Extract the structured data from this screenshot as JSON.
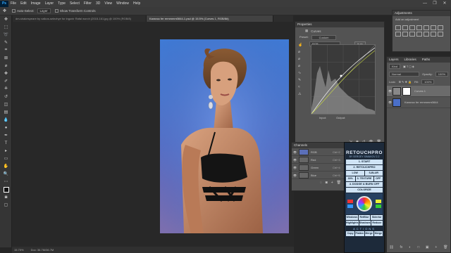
{
  "menubar": {
    "logo": "Ps",
    "items": [
      "File",
      "Edit",
      "Image",
      "Layer",
      "Type",
      "Select",
      "Filter",
      "3D",
      "View",
      "Window",
      "Help"
    ],
    "window_controls": [
      "—",
      "❐",
      "✕"
    ]
  },
  "options": {
    "auto_select_label": "Auto-Select:",
    "auto_select_value": "Layer",
    "transform_label": "Show Transform Controls"
  },
  "tabs": [
    {
      "label": "dm-shakespeare by valkos-selezhye for ingonir Rafal worch (2015-161.jpg @ 100% (RGB/8)",
      "active": false
    },
    {
      "label": "Karanoc fer ermmmm0844-1.psd @ 15.5% (Curves 1, RGB/8#)",
      "active": true
    }
  ],
  "status": {
    "zoom": "15.75%",
    "doc": "Doc: 36.7M/36.7M"
  },
  "properties": {
    "tabs": [
      "Properties"
    ],
    "title": "Curves",
    "preset_label": "Preset:",
    "preset_value": "Custom",
    "channel_value": "RGB",
    "auto_label": "Auto",
    "input_label": "Input:",
    "output_label": "Output:"
  },
  "channels": {
    "tabs": [
      "Channels"
    ],
    "rows": [
      {
        "name": "RGB",
        "shortcut": "Ctrl+2"
      },
      {
        "name": "Red",
        "shortcut": "Ctrl+3"
      },
      {
        "name": "Green",
        "shortcut": "Ctrl+4"
      },
      {
        "name": "Blue",
        "shortcut": "Ctrl+5"
      }
    ]
  },
  "retouch": {
    "title": "RETOUCHPRO",
    "subtitle": "BY SERGEY SIMAKOV 2.2",
    "start": "1. START",
    "retouchpro": "2. RETOUCHPRO",
    "low": "LOW",
    "blur": "S-BLUR",
    "pct": "30%",
    "texture": "3. TEXTURE",
    "off": "OFF",
    "dodge": "4. DODGE & BURN OFF",
    "colorize": "COLORIZE",
    "row_a": [
      "Windows",
      "RetBlur",
      "Skinrtor"
    ],
    "row_b": [
      "Highlights",
      "Shadows",
      "Reduce"
    ],
    "actions": "ACTIONS",
    "row_c": [
      "Copy",
      "Flatten",
      "Merge",
      "Merge"
    ]
  },
  "adjustments": {
    "tabs": [
      "Adjustments"
    ],
    "add_label": "Add an adjustment"
  },
  "libraries": {
    "tabs": [
      "Libraries",
      "Paths"
    ]
  },
  "layers": {
    "tabs": [
      "Layers"
    ],
    "kind_label": "Kind",
    "blend_value": "Normal",
    "opacity_label": "Opacity:",
    "opacity_value": "100%",
    "lock_label": "Lock:",
    "fill_label": "Fill:",
    "fill_value": "100%",
    "rows": [
      {
        "name": "Curves 1",
        "selected": true
      },
      {
        "name": "Karanoc fer ermmmm0844",
        "selected": false
      }
    ],
    "buttons": [
      "fx",
      "◐",
      "□",
      "▣",
      "+",
      "🗑"
    ]
  }
}
